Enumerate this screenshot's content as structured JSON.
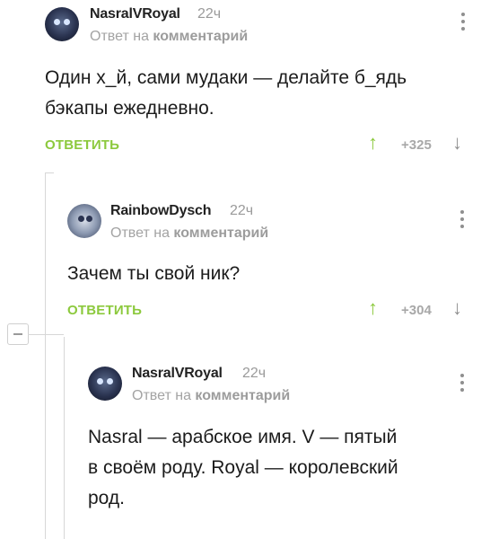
{
  "comments": [
    {
      "username": "NasralVRoyal",
      "time": "22ч",
      "reply_prefix": "Ответ на",
      "reply_target": "комментарий",
      "text_line1": "Один х_й, сами мудаки — делайте б_ядь",
      "text_line2": "бэкапы ежедневно.",
      "answer_label": "ОТВЕТИТЬ",
      "rating": "+325"
    },
    {
      "username": "RainbowDysch",
      "time": "22ч",
      "reply_prefix": "Ответ на",
      "reply_target": "комментарий",
      "text_line1": "Зачем ты свой ник?",
      "answer_label": "ОТВЕТИТЬ",
      "rating": "+304"
    },
    {
      "username": "NasralVRoyal",
      "time": "22ч",
      "reply_prefix": "Ответ на",
      "reply_target": "комментарий",
      "text_line1": "Nasral — арабское имя. V — пятый",
      "text_line2": "в своём роду. Royal — королевский",
      "text_line3": "род."
    }
  ],
  "icons": {
    "up": "arrow-up-icon",
    "down": "arrow-down-icon",
    "menu": "more-vertical-icon",
    "collapse": "collapse-minus-icon"
  },
  "colors": {
    "accent_green": "#8cc93d",
    "muted_gray": "#9a9a9a",
    "thread_line": "#d7d7d7"
  }
}
